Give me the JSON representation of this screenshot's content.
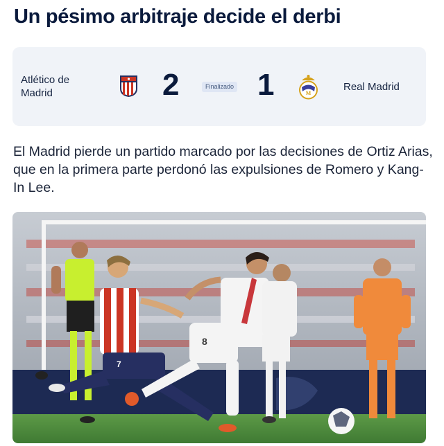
{
  "headline": "Un pésimo arbitraje decide el derbi",
  "match": {
    "home_team": "Atlético de Madrid",
    "away_team": "Real Madrid",
    "home_score": "2",
    "away_score": "1",
    "status": "Finalizado",
    "home_crest_icon": "atletico-madrid-crest-icon",
    "away_crest_icon": "real-madrid-crest-icon"
  },
  "summary": "El Madrid pierde un partido marcado por las decisiones de Ortiz Arias, que en la primera parte perdonó las expulsiones de Romero y Kang-In Lee.",
  "photo": {
    "description_icon": "match-photo",
    "player_numbers": [
      "7",
      "8"
    ]
  },
  "colors": {
    "headline": "#0a1a3c",
    "scorecard_bg": "#f0f3f8",
    "badge_bg": "#dfe6f4",
    "atletico_red": "#cb3524",
    "atletico_blue": "#262f61",
    "pitch_green": "#4d8a3b"
  }
}
